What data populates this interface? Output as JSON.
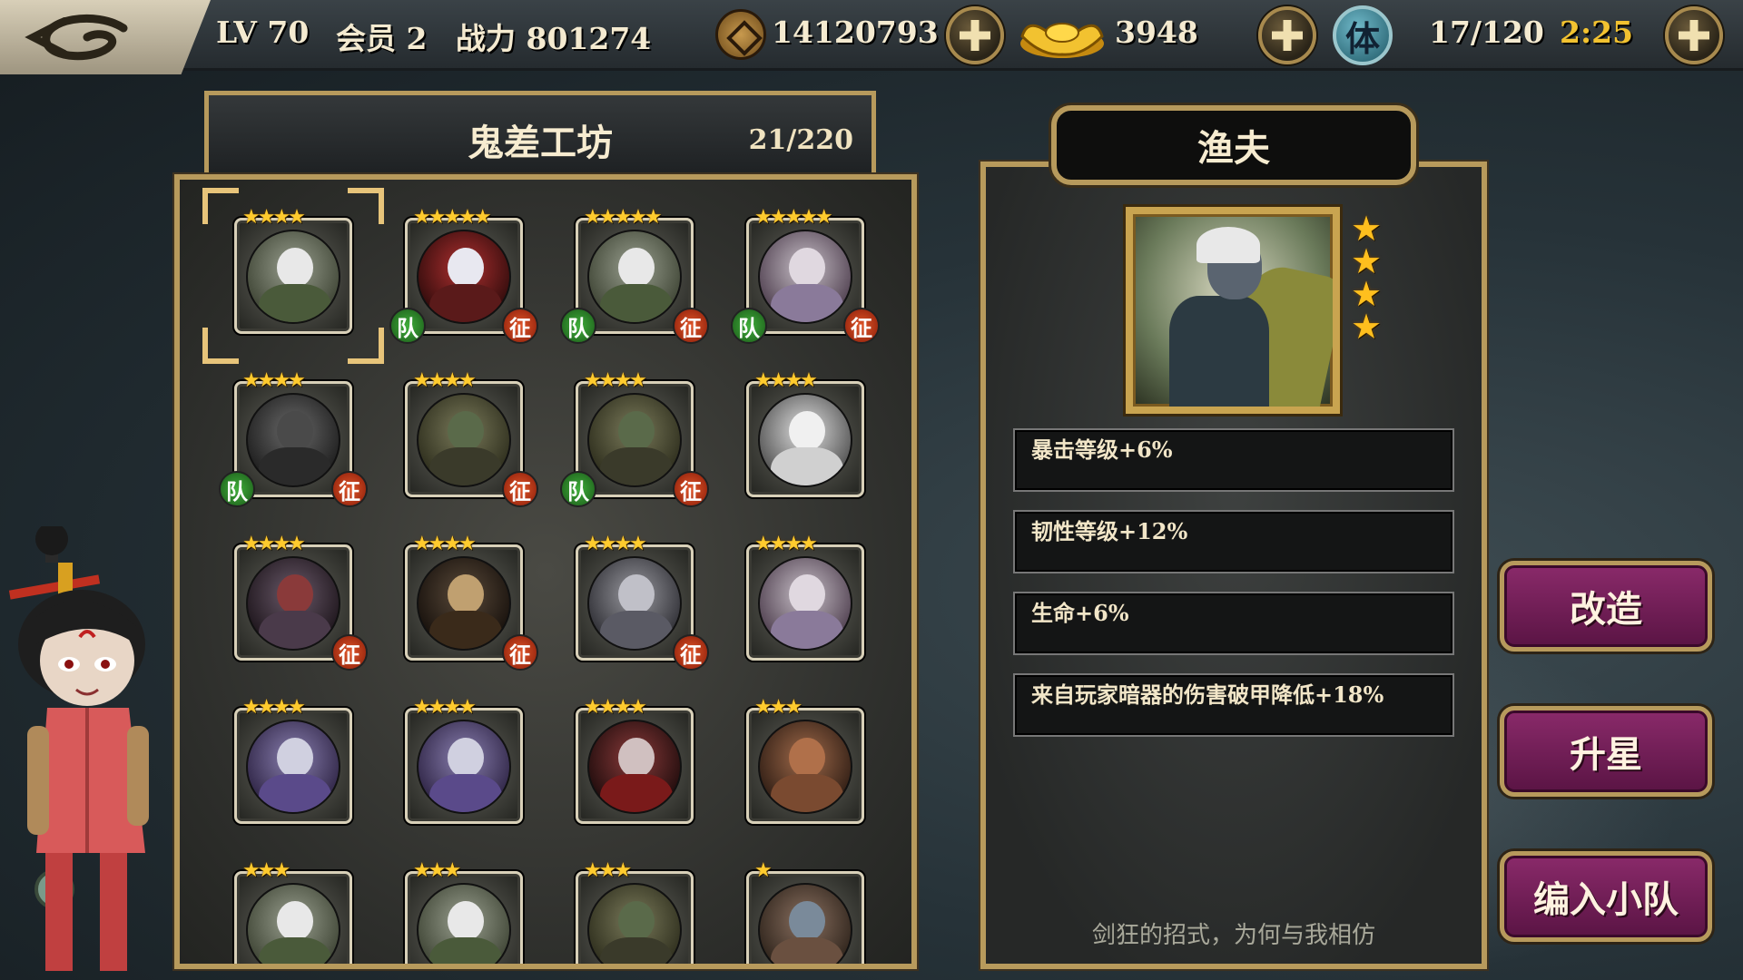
{
  "topbar": {
    "level": "LV 70",
    "vip": "会员 2",
    "power": "战力 801274",
    "coins": "14120793",
    "gold": "3948",
    "stamina_label": "体",
    "stamina": "17/120",
    "timer": "2:25"
  },
  "left": {
    "title": "鬼差工坊",
    "capacity": "21/220"
  },
  "roster": [
    {
      "stars": "★★★★",
      "team": false,
      "exp": false,
      "selected": true,
      "c1": "#9aa090",
      "c2": "#3a4030",
      "face": "#e8e8e8",
      "body": "#4a5a3a"
    },
    {
      "stars": "★★★★★",
      "team": true,
      "exp": true,
      "selected": false,
      "c1": "#b03030",
      "c2": "#2a0a0a",
      "face": "#e8e8f0",
      "body": "#5a1a1a"
    },
    {
      "stars": "★★★★★",
      "team": true,
      "exp": true,
      "selected": false,
      "c1": "#9aa090",
      "c2": "#3a4030",
      "face": "#e8e8e8",
      "body": "#4a5a3a"
    },
    {
      "stars": "★★★★★",
      "team": true,
      "exp": true,
      "selected": false,
      "c1": "#c8c0c8",
      "c2": "#4a3a4a",
      "face": "#e0d8e0",
      "body": "#8a7a9a"
    },
    {
      "stars": "★★★★",
      "team": true,
      "exp": true,
      "selected": false,
      "c1": "#6a6a6a",
      "c2": "#1a1a1a",
      "face": "#4a4a4a",
      "body": "#2a2a2a"
    },
    {
      "stars": "★★★★",
      "team": false,
      "exp": true,
      "selected": false,
      "c1": "#7a7a5a",
      "c2": "#2a2a1a",
      "face": "#5a6a4a",
      "body": "#3a3a2a"
    },
    {
      "stars": "★★★★",
      "team": true,
      "exp": true,
      "selected": false,
      "c1": "#7a7a5a",
      "c2": "#2a2a1a",
      "face": "#5a6a4a",
      "body": "#3a3a2a"
    },
    {
      "stars": "★★★★",
      "team": false,
      "exp": false,
      "selected": false,
      "c1": "#e0e0e0",
      "c2": "#4a4a4a",
      "face": "#f0f0f0",
      "body": "#d0d0d0"
    },
    {
      "stars": "★★★★",
      "team": false,
      "exp": true,
      "selected": false,
      "c1": "#6a5a6a",
      "c2": "#1a1218",
      "face": "#8a3a3a",
      "body": "#4a3a4a"
    },
    {
      "stars": "★★★★",
      "team": false,
      "exp": true,
      "selected": false,
      "c1": "#5a4a3a",
      "c2": "#140e0a",
      "face": "#c0a070",
      "body": "#3a2a1a"
    },
    {
      "stars": "★★★★",
      "team": false,
      "exp": true,
      "selected": false,
      "c1": "#9a9aa0",
      "c2": "#2a2a30",
      "face": "#c0c0c8",
      "body": "#5a5a64"
    },
    {
      "stars": "★★★★",
      "team": false,
      "exp": false,
      "selected": false,
      "c1": "#c8c0c8",
      "c2": "#4a3a4a",
      "face": "#e0d8e0",
      "body": "#8a7a9a"
    },
    {
      "stars": "★★★★",
      "team": false,
      "exp": false,
      "selected": false,
      "c1": "#8a80b0",
      "c2": "#2a2040",
      "face": "#d0d0e0",
      "body": "#5a4a8a"
    },
    {
      "stars": "★★★★",
      "team": false,
      "exp": false,
      "selected": false,
      "c1": "#8a80b0",
      "c2": "#2a2040",
      "face": "#d0d0e0",
      "body": "#5a4a8a"
    },
    {
      "stars": "★★★★",
      "team": false,
      "exp": false,
      "selected": false,
      "c1": "#8a3a3a",
      "c2": "#1a0a0a",
      "face": "#d0c0c0",
      "body": "#7a1a1a"
    },
    {
      "stars": "★★★",
      "team": false,
      "exp": false,
      "selected": false,
      "c1": "#a06a4a",
      "c2": "#2a1a12",
      "face": "#b0704a",
      "body": "#7a4a30"
    },
    {
      "stars": "★★★",
      "team": false,
      "exp": false,
      "selected": false,
      "c1": "#9aa090",
      "c2": "#3a4030",
      "face": "#e8e8e8",
      "body": "#4a5a3a"
    },
    {
      "stars": "★★★",
      "team": false,
      "exp": false,
      "selected": false,
      "c1": "#9aa090",
      "c2": "#3a4030",
      "face": "#e8e8e8",
      "body": "#4a5a3a"
    },
    {
      "stars": "★★★",
      "team": false,
      "exp": false,
      "selected": false,
      "c1": "#7a7a5a",
      "c2": "#2a2a1a",
      "face": "#5a6a4a",
      "body": "#3a3a2a"
    },
    {
      "stars": "★",
      "team": false,
      "exp": false,
      "selected": false,
      "c1": "#8a7060",
      "c2": "#2a2018",
      "face": "#7a8a9a",
      "body": "#6a5040"
    }
  ],
  "badges": {
    "team": "队",
    "exp": "征"
  },
  "detail": {
    "name": "渔夫",
    "stars": 4,
    "attributes": [
      "暴击等级+6%",
      "韧性等级+12%",
      "生命+6%",
      "来自玩家暗器的伤害破甲降低+18%"
    ],
    "quote": "剑狂的招式，为何与我相仿"
  },
  "actions": {
    "modify": "改造",
    "star_up": "升星",
    "join_team": "编入小队"
  },
  "colors": {
    "gold_frame": "#b79a5c",
    "star": "#ffcb2e",
    "team_badge": "#3fae3a",
    "exp_badge": "#e0562a",
    "action_button": "#8a2a6a"
  }
}
